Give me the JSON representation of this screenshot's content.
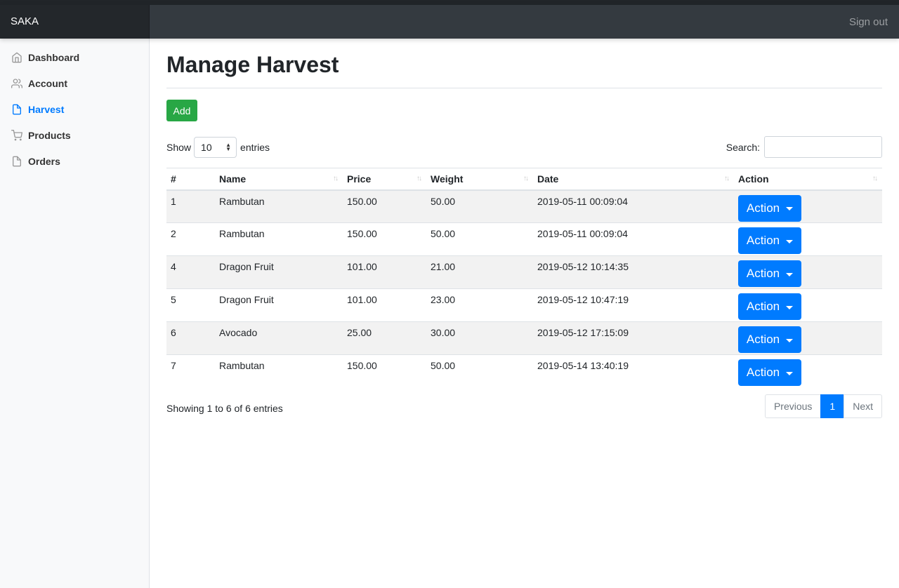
{
  "brand": "SAKA",
  "header": {
    "signout": "Sign out"
  },
  "sidebar": {
    "items": [
      {
        "label": "Dashboard",
        "icon": "home-icon"
      },
      {
        "label": "Account",
        "icon": "users-icon"
      },
      {
        "label": "Harvest",
        "icon": "file-icon",
        "active": true
      },
      {
        "label": "Products",
        "icon": "shopping-cart-icon"
      },
      {
        "label": "Orders",
        "icon": "file-icon"
      }
    ]
  },
  "page": {
    "title": "Manage Harvest",
    "add_label": "Add"
  },
  "table_controls": {
    "show_label": "Show",
    "entries_value": "10",
    "entries_label": "entries",
    "search_label": "Search:",
    "search_value": ""
  },
  "table": {
    "columns": [
      "#",
      "Name",
      "Price",
      "Weight",
      "Date",
      "Action"
    ],
    "action_label": "Action",
    "rows": [
      [
        "1",
        "Rambutan",
        "150.00",
        "50.00",
        "2019-05-11 00:09:04"
      ],
      [
        "2",
        "Rambutan",
        "150.00",
        "50.00",
        "2019-05-11 00:09:04"
      ],
      [
        "4",
        "Dragon Fruit",
        "101.00",
        "21.00",
        "2019-05-12 10:14:35"
      ],
      [
        "5",
        "Dragon Fruit",
        "101.00",
        "23.00",
        "2019-05-12 10:47:19"
      ],
      [
        "6",
        "Avocado",
        "25.00",
        "30.00",
        "2019-05-12 17:15:09"
      ],
      [
        "7",
        "Rambutan",
        "150.00",
        "50.00",
        "2019-05-14 13:40:19"
      ]
    ]
  },
  "footer": {
    "info": "Showing 1 to 6 of 6 entries",
    "previous": "Previous",
    "page": "1",
    "next": "Next"
  },
  "colors": {
    "primary": "#007bff",
    "success": "#28a745",
    "navbar": "#343a40",
    "brand_bg": "#23272b"
  }
}
